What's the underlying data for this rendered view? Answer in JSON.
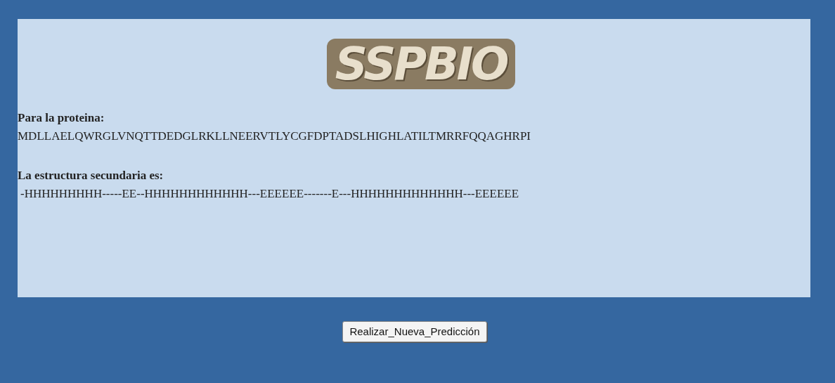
{
  "logo": "SSPBIO",
  "protein_label": "Para la proteina:",
  "protein_sequence": "MDLLAELQWRGLVNQTTDEDGLRKLLNEERVTLYCGFDPTADSLHIGHLATILTMRRFQQAGHRPI",
  "structure_label": "La estructura secundaria es:",
  "structure_sequence": "-HHHHHHHHH-----EE--HHHHHHHHHHHH---EEEEEE-------E---HHHHHHHHHHHHH---EEEEEE",
  "button": "Realizar_Nueva_Predicción"
}
